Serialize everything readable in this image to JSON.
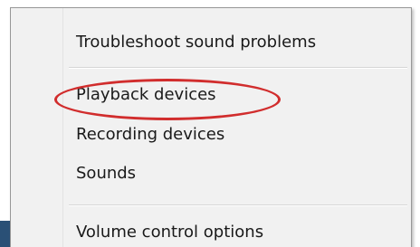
{
  "menu": {
    "items": [
      {
        "label": "Troubleshoot sound problems"
      },
      {
        "label": "Playback devices"
      },
      {
        "label": "Recording devices"
      },
      {
        "label": "Sounds"
      },
      {
        "label": "Volume control options"
      }
    ]
  },
  "annotation": {
    "highlight_color": "#d12d2d"
  }
}
